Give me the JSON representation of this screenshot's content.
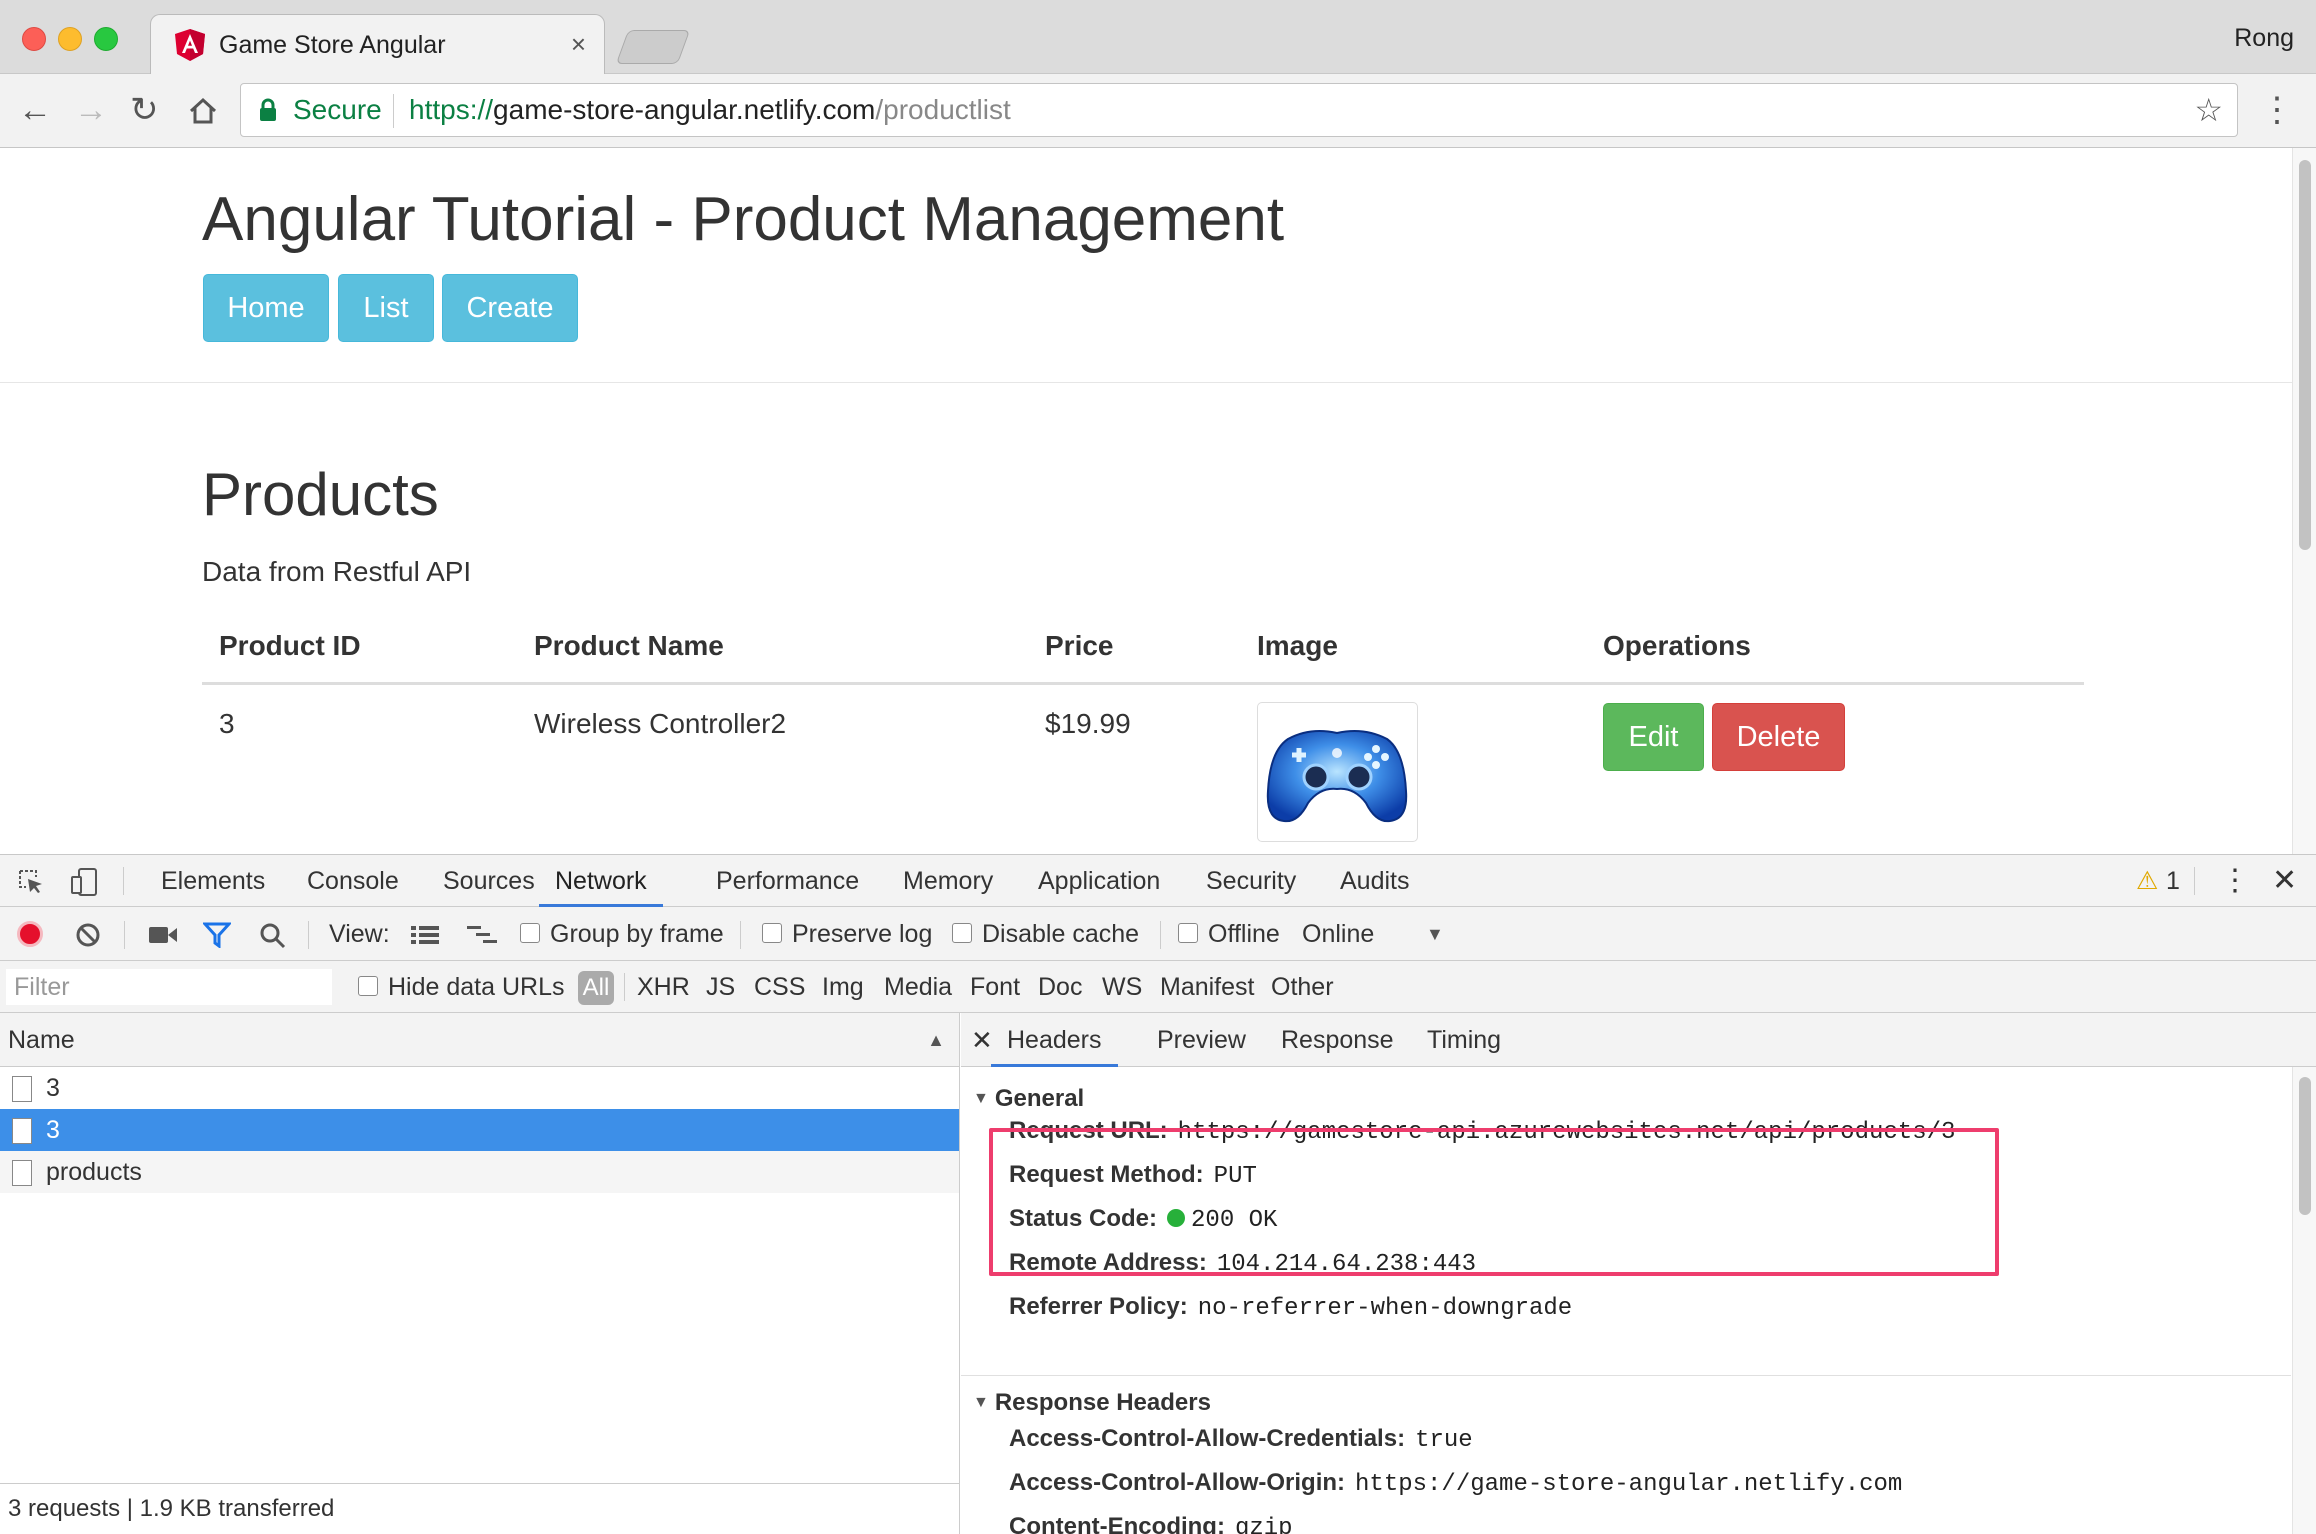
{
  "browser": {
    "tab_title": "Game Store Angular",
    "tab_close": "×",
    "user": "Rong",
    "secure_label": "Secure",
    "url_scheme": "https://",
    "url_host": "game-store-angular.netlify.com",
    "url_path": "/productlist"
  },
  "page": {
    "title": "Angular Tutorial - Product Management",
    "nav": [
      "Home",
      "List",
      "Create"
    ],
    "heading": "Products",
    "lead": "Data from Restful API",
    "table": {
      "headers": [
        "Product ID",
        "Product Name",
        "Price",
        "Image",
        "Operations"
      ],
      "rows": [
        {
          "id": "3",
          "name": "Wireless Controller2",
          "price": "$19.99",
          "image": "controller",
          "edit": "Edit",
          "delete": "Delete"
        }
      ]
    }
  },
  "devtools": {
    "tabs": [
      "Elements",
      "Console",
      "Sources",
      "Network",
      "Performance",
      "Memory",
      "Application",
      "Security",
      "Audits"
    ],
    "active_tab": "Network",
    "warning_count": "1",
    "toolbar": {
      "view_label": "View:",
      "group_by_frame": "Group by frame",
      "preserve_log": "Preserve log",
      "disable_cache": "Disable cache",
      "offline": "Offline",
      "online": "Online"
    },
    "filter_placeholder": "Filter",
    "hide_data_urls": "Hide data URLs",
    "types": [
      "All",
      "XHR",
      "JS",
      "CSS",
      "Img",
      "Media",
      "Font",
      "Doc",
      "WS",
      "Manifest",
      "Other"
    ],
    "name_header": "Name",
    "requests": [
      "3",
      "3",
      "products"
    ],
    "selected_request": 1,
    "footer": "3 requests | 1.9 KB transferred",
    "detail_tabs": [
      "Headers",
      "Preview",
      "Response",
      "Timing"
    ],
    "general_title": "General",
    "general": [
      {
        "key": "Request URL:",
        "value": "https://gamestore-api.azurewebsites.net/api/products/3"
      },
      {
        "key": "Request Method:",
        "value": "PUT"
      },
      {
        "key": "Status Code:",
        "value": "200 OK"
      },
      {
        "key": "Remote Address:",
        "value": "104.214.64.238:443"
      },
      {
        "key": "Referrer Policy:",
        "value": "no-referrer-when-downgrade"
      }
    ],
    "response_title": "Response Headers",
    "response": [
      {
        "key": "Access-Control-Allow-Credentials:",
        "value": "true"
      },
      {
        "key": "Access-Control-Allow-Origin:",
        "value": "https://game-store-angular.netlify.com"
      },
      {
        "key": "Content-Encoding:",
        "value": "gzip"
      }
    ]
  },
  "colors": {
    "info_button": "#5bc0de",
    "success_button": "#5cb85c",
    "danger_button": "#d9534f",
    "selected_row": "#3d8fe8",
    "highlight_box": "#ee3d6d",
    "status_ok": "#27b03a"
  }
}
